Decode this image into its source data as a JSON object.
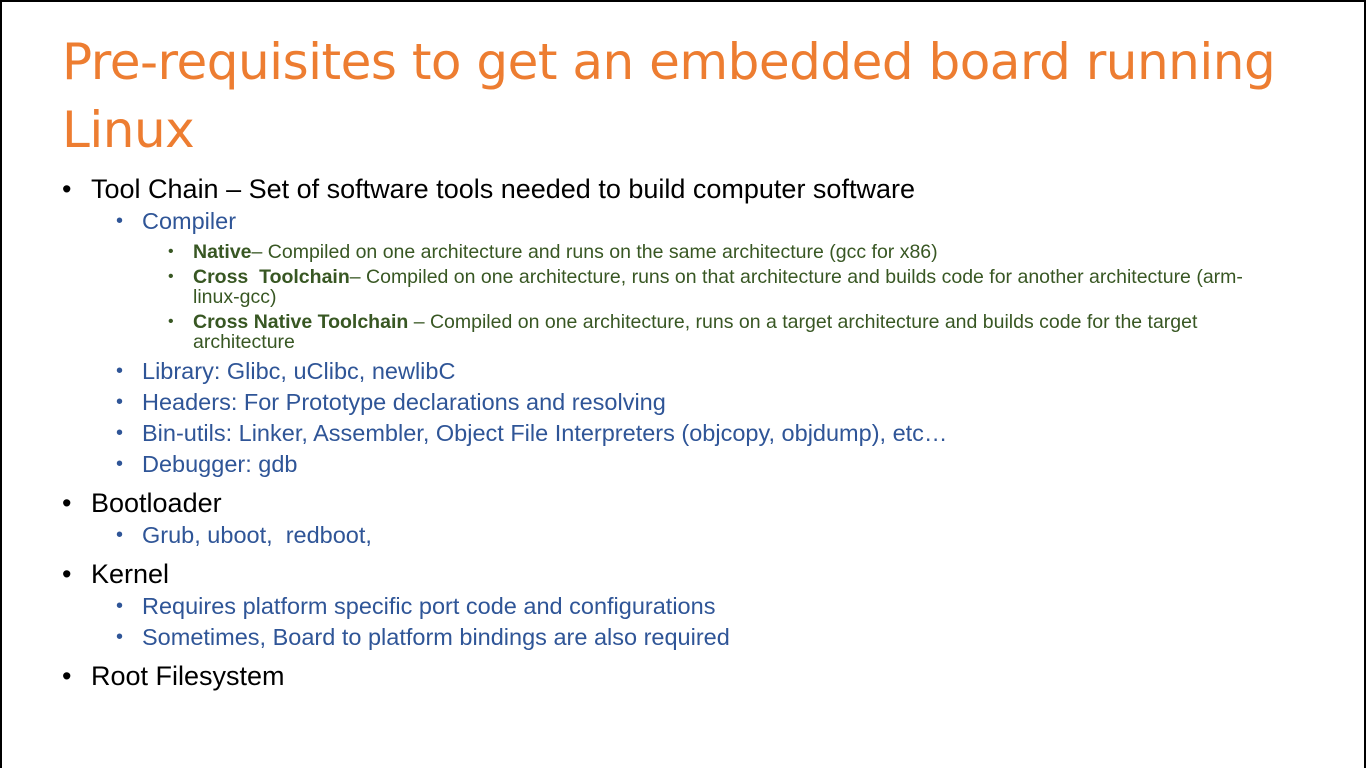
{
  "slide": {
    "title": "Pre-requisites to get an embedded board running Linux",
    "bullet_char": "•",
    "sections": [
      {
        "heading": "Tool Chain – Set of software tools needed to build computer software",
        "items": [
          {
            "text": "Compiler",
            "subitems": [
              {
                "term": "Native",
                "desc": "– Compiled on one architecture and runs on the same architecture (gcc for x86)"
              },
              {
                "term": "Cross  Toolchain",
                "desc": "– Compiled on one architecture, runs on that architecture and builds code for another architecture (arm-linux-gcc)"
              },
              {
                "term": "Cross Native Toolchain",
                "desc": " – Compiled on one architecture, runs on a target architecture and builds code for the target architecture"
              }
            ]
          },
          {
            "text": "Library: Glibc, uClibc, newlibC"
          },
          {
            "text": "Headers: For Prototype declarations and resolving"
          },
          {
            "text": "Bin-utils: Linker, Assembler, Object File Interpreters (objcopy, objdump), etc…"
          },
          {
            "text": "Debugger: gdb"
          }
        ]
      },
      {
        "heading": "Bootloader",
        "items": [
          {
            "text": "Grub, uboot,  redboot,"
          }
        ]
      },
      {
        "heading": "Kernel",
        "items": [
          {
            "text": "Requires platform specific port code and configurations"
          },
          {
            "text": "Sometimes, Board to platform bindings are also required"
          }
        ]
      },
      {
        "heading": "Root Filesystem",
        "items": []
      }
    ]
  },
  "colors": {
    "title": "#ED7D31",
    "level1": "#000000",
    "level2": "#2F5597",
    "level3": "#385723"
  }
}
